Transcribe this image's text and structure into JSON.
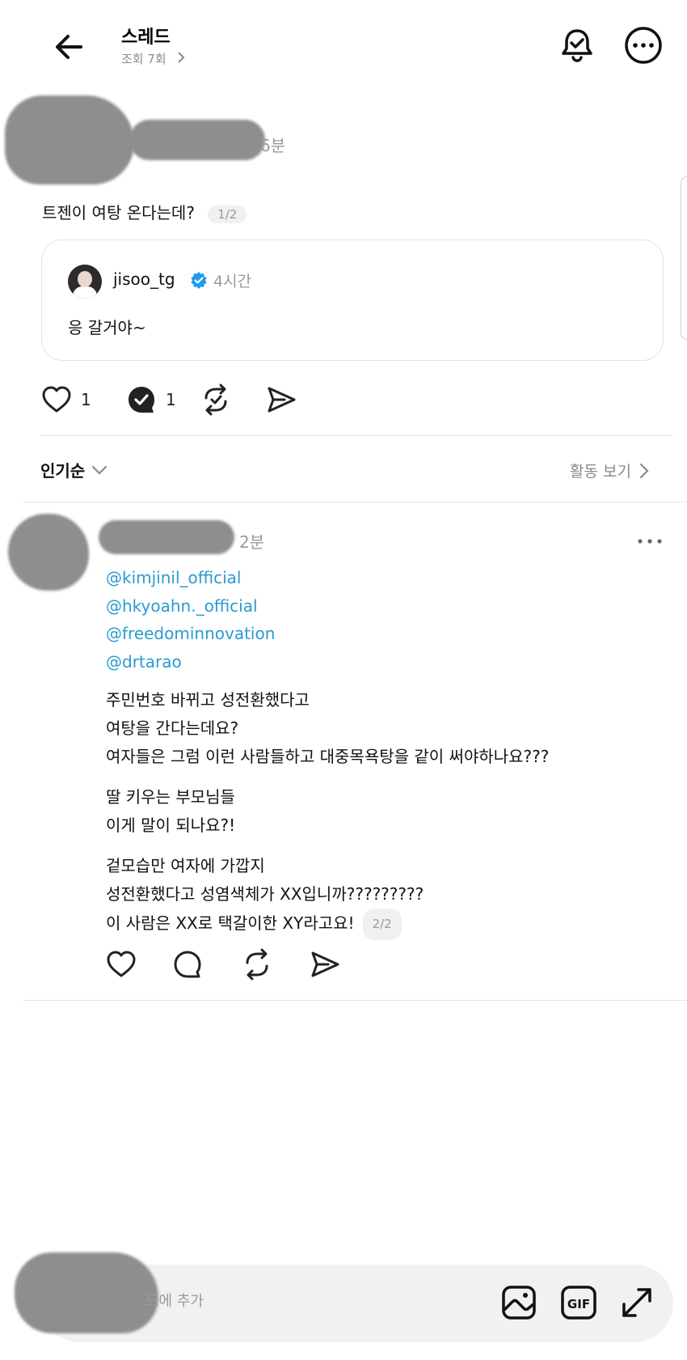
{
  "header": {
    "title": "스레드",
    "views": "조회 7회"
  },
  "post": {
    "time": "6분",
    "text": "트젠이 여탕 온다는데?",
    "page": "1/2",
    "quote": {
      "username": "jisoo_tg",
      "time": "4시간",
      "text": "응 갈거야~"
    },
    "likes": "1",
    "replies": "1"
  },
  "sort": {
    "label": "인기순",
    "activity_label": "활동 보기"
  },
  "reply": {
    "time": "2분",
    "mentions": [
      "@kimjinil_official",
      "@hkyoahn._official",
      "@freedominnovation",
      "@drtarao"
    ],
    "paragraphs": [
      [
        "주민번호 바뀌고 성전환했다고",
        "여탕을 간다는데요?",
        "여자들은 그럼 이런 사람들하고 대중목욕탕을 같이 써야하나요???"
      ],
      [
        "딸 키우는 부모님들",
        "이게 말이 되나요?!"
      ],
      [
        "겉모습만 여자에 가깝지",
        "성전환했다고 성염색체가 XX입니까?????????",
        "이 사람은 XX로 택갈이한 XY라고요!"
      ]
    ],
    "page": "2/2"
  },
  "compose": {
    "placeholder": "드에 추가"
  },
  "icons": {
    "back": "arrow-left-icon",
    "bell": "bell-check-icon",
    "more": "more-horizontal-icon",
    "verified": "verified-badge-icon",
    "heart": "heart-icon",
    "comment": "comment-icon",
    "repost": "repost-icon",
    "share": "send-icon",
    "image": "image-icon",
    "gif": "gif-icon",
    "expand": "expand-icon"
  },
  "colors": {
    "mention": "#2a9bd0",
    "verified": "#1d9bf0",
    "muted": "#9a9a9a"
  }
}
